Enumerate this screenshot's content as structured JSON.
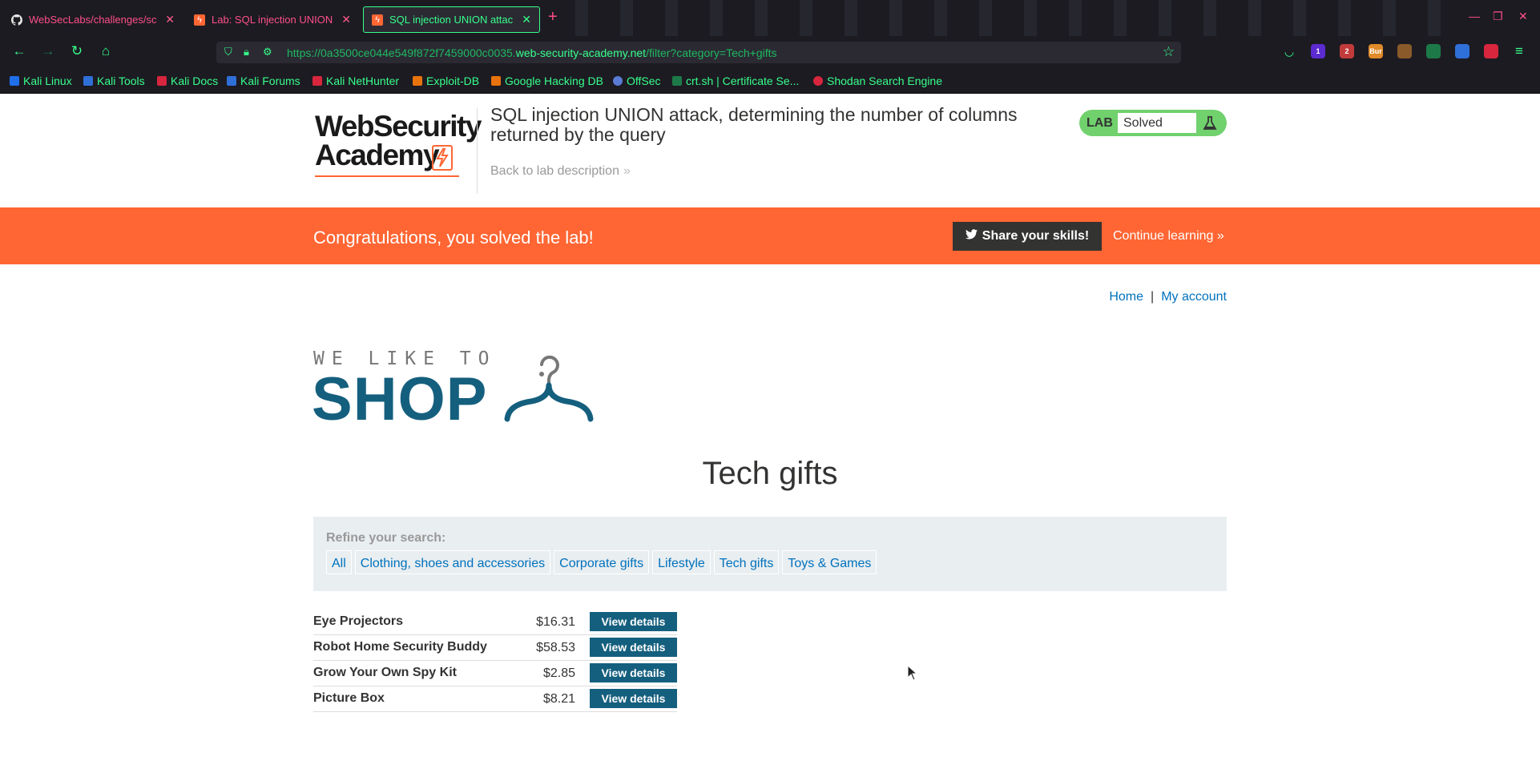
{
  "browser": {
    "tabs": [
      {
        "label": "WebSecLabs/challenges/sc",
        "icon": "github-icon"
      },
      {
        "label": "Lab: SQL injection UNION",
        "icon": "portswigger-icon"
      },
      {
        "label": "SQL injection UNION attac",
        "icon": "portswigger-icon",
        "active": true
      }
    ],
    "url": {
      "prefix": "https://0a3500ce044e549f872f7459000c0035.",
      "domain": "web-security-academy.net",
      "path": "/filter?category=Tech+gifts"
    },
    "extensions": [
      {
        "name": "pocket-icon",
        "badge": ""
      },
      {
        "name": "extension-badge-1",
        "badge": "1"
      },
      {
        "name": "extension-badge-2",
        "badge": "2"
      },
      {
        "name": "burp-extension",
        "badge": "Bur"
      },
      {
        "name": "foxyproxy-icon",
        "badge": ""
      },
      {
        "name": "wappalyzer-icon",
        "badge": ""
      },
      {
        "name": "tools-icon",
        "badge": ""
      },
      {
        "name": "hack-tools-icon",
        "badge": ""
      }
    ],
    "bookmarks": [
      {
        "label": "Kali Linux",
        "color": "#1f6feb"
      },
      {
        "label": "Kali Tools",
        "color": "#2f6fd8"
      },
      {
        "label": "Kali Docs",
        "color": "#d7263d"
      },
      {
        "label": "Kali Forums",
        "color": "#2f6fd8"
      },
      {
        "label": "Kali NetHunter",
        "color": "#d7263d"
      },
      {
        "label": "Exploit-DB",
        "color": "#e8730c"
      },
      {
        "label": "Google Hacking DB",
        "color": "#e8730c"
      },
      {
        "label": "OffSec",
        "color": "#5a7bd6"
      },
      {
        "label": "crt.sh | Certificate Se...",
        "color": "#37ff8b"
      },
      {
        "label": "Shodan Search Engine",
        "color": "#d7263d"
      }
    ]
  },
  "lab": {
    "logo_line1": "WebSecurity",
    "logo_line2": "Academy",
    "title": "SQL injection UNION attack, determining the number of columns returned by the query",
    "back_link": "Back to lab description",
    "status_label": "LAB",
    "status_value": "Solved"
  },
  "banner": {
    "message": "Congratulations, you solved the lab!",
    "share_label": "Share your skills!",
    "continue_label": "Continue learning"
  },
  "nav": {
    "home": "Home",
    "separator": "|",
    "account": "My account"
  },
  "shop": {
    "tagline": "WE LIKE TO",
    "name": "SHOP"
  },
  "category_title": "Tech gifts",
  "refine": {
    "label": "Refine your search:",
    "filters": [
      "All",
      "Clothing, shoes and accessories",
      "Corporate gifts",
      "Lifestyle",
      "Tech gifts",
      "Toys & Games"
    ]
  },
  "products": [
    {
      "name": "Eye Projectors",
      "price": "$16.31",
      "button": "View details"
    },
    {
      "name": "Robot Home Security Buddy",
      "price": "$58.53",
      "button": "View details"
    },
    {
      "name": "Grow Your Own Spy Kit",
      "price": "$2.85",
      "button": "View details"
    },
    {
      "name": "Picture Box",
      "price": "$8.21",
      "button": "View details"
    }
  ],
  "colors": {
    "accent_orange": "#ff6633",
    "shop_blue": "#155f7e",
    "link_blue": "#0071bc",
    "solved_green": "#70d16d",
    "browser_green": "#37ff8b",
    "browser_pink": "#ff4f87"
  }
}
